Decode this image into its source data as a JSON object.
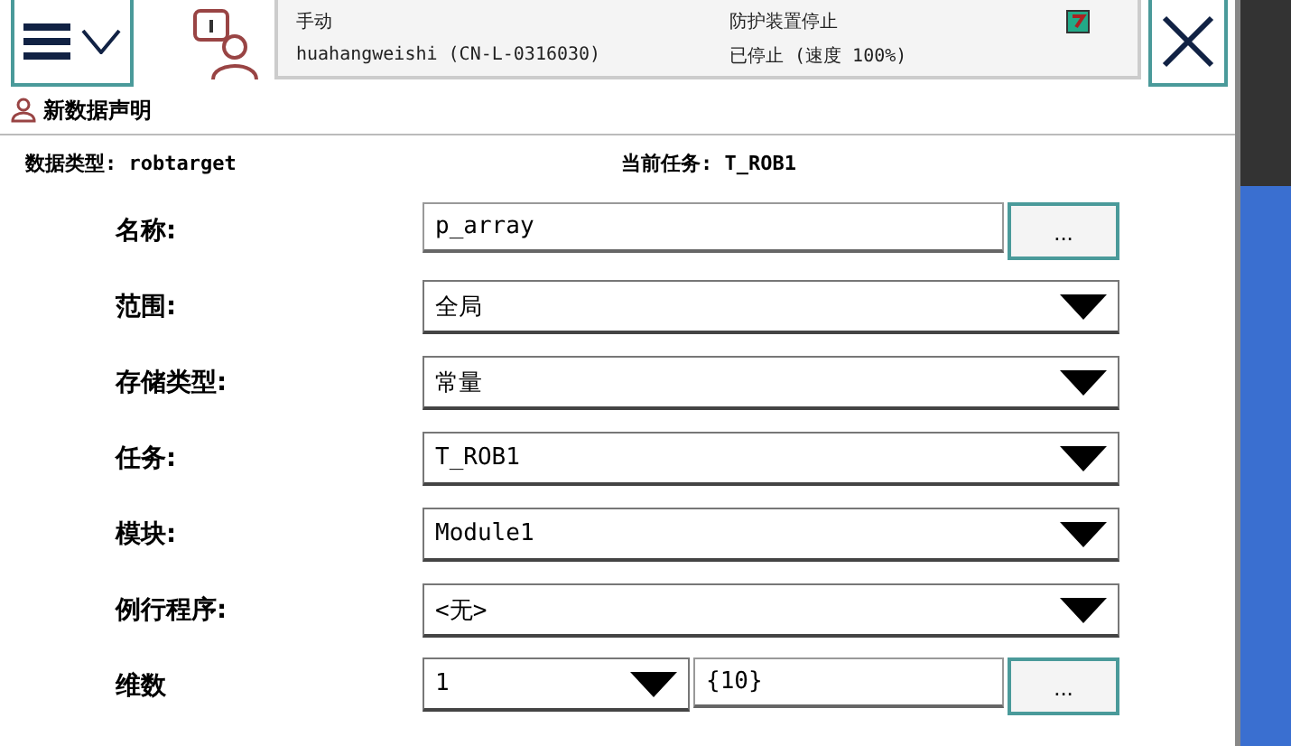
{
  "status": {
    "mode": "手动",
    "controller": "huahangweishi (CN-L-0316030)",
    "guard": "防护装置停止",
    "state": "已停止 (速度 100%)"
  },
  "page_title": "新数据声明",
  "info": {
    "data_type_label": "数据类型:",
    "data_type": "robtarget",
    "task_label": "当前任务:",
    "task": "T_ROB1"
  },
  "fields": [
    {
      "kind": "text",
      "label": "名称:",
      "value": "p_array",
      "button": "..."
    },
    {
      "kind": "dropdown",
      "label": "范围:",
      "value": "全局"
    },
    {
      "kind": "dropdown",
      "label": "存储类型:",
      "value": "常量"
    },
    {
      "kind": "dropdown",
      "label": "任务:",
      "value": "T_ROB1"
    },
    {
      "kind": "dropdown",
      "label": "模块:",
      "value": "Module1"
    },
    {
      "kind": "dropdown",
      "label": "例行程序:",
      "value": "<无>"
    },
    {
      "kind": "dimension",
      "label": "维数",
      "value": "1",
      "extra": "{10}",
      "button": "..."
    }
  ]
}
